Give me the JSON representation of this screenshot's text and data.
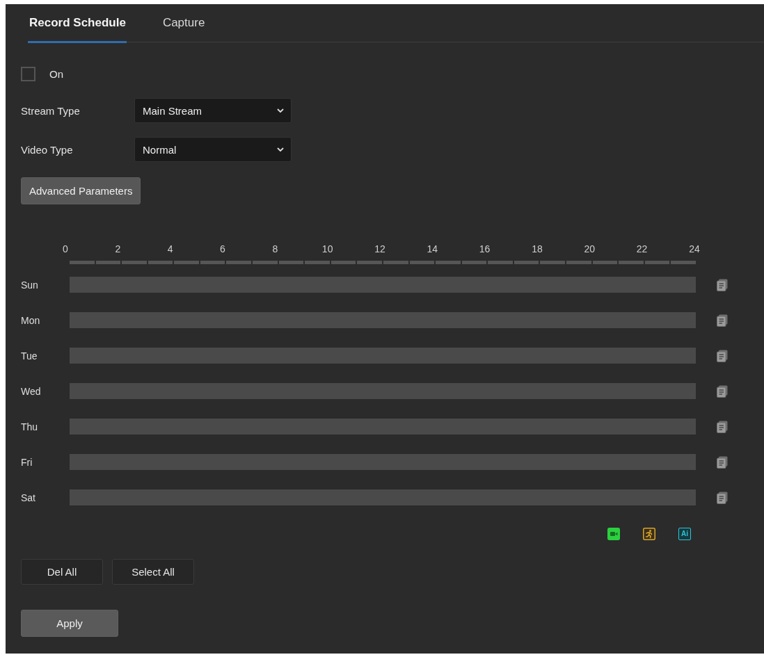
{
  "tabs": [
    {
      "label": "Record Schedule",
      "selected": true
    },
    {
      "label": "Capture",
      "selected": false
    }
  ],
  "enable": {
    "label": "On",
    "checked": false
  },
  "fields": [
    {
      "label": "Stream Type",
      "value": "Main Stream"
    },
    {
      "label": "Video Type",
      "value": "Normal"
    }
  ],
  "advanced_button": "Advanced Parameters",
  "schedule": {
    "hours": [
      "0",
      "2",
      "4",
      "6",
      "8",
      "10",
      "12",
      "14",
      "16",
      "18",
      "20",
      "22",
      "24"
    ],
    "days": [
      {
        "name": "Sun"
      },
      {
        "name": "Mon"
      },
      {
        "name": "Tue"
      },
      {
        "name": "Wed"
      },
      {
        "name": "Thu"
      },
      {
        "name": "Fri"
      },
      {
        "name": "Sat"
      }
    ]
  },
  "legend": [
    {
      "kind": "camera",
      "color": "#2bd13f"
    },
    {
      "kind": "motion",
      "color": "#d9a62c"
    },
    {
      "kind": "ai",
      "label": "Ai",
      "color": "#2fc4d6"
    }
  ],
  "buttons": [
    "Del All",
    "Select All"
  ],
  "apply_button": "Apply"
}
